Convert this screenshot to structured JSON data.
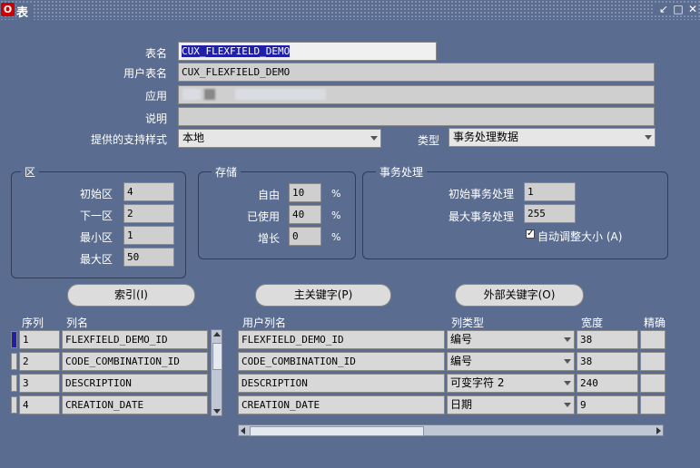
{
  "window": {
    "title": "表",
    "logo": "O"
  },
  "form": {
    "table_name_label": "表名",
    "table_name_value": "CUX_FLEXFIELD_DEMO",
    "user_table_name_label": "用户表名",
    "user_table_name_value": "CUX_FLEXFIELD_DEMO",
    "application_label": "应用",
    "description_label": "说明",
    "support_style_label": "提供的支持样式",
    "support_style_value": "本地",
    "type_label": "类型",
    "type_value": "事务处理数据"
  },
  "extent_group": {
    "title": "区",
    "initial_label": "初始区",
    "initial_value": "4",
    "next_label": "下一区",
    "next_value": "2",
    "min_label": "最小区",
    "min_value": "1",
    "max_label": "最大区",
    "max_value": "50"
  },
  "storage_group": {
    "title": "存储",
    "free_label": "自由",
    "free_value": "10",
    "used_label": "已使用",
    "used_value": "40",
    "growth_label": "增长",
    "growth_value": "0",
    "pct": "%"
  },
  "transaction_group": {
    "title": "事务处理",
    "initial_label": "初始事务处理",
    "initial_value": "1",
    "max_label": "最大事务处理",
    "max_value": "255",
    "autosize_label": "自动调整大小 (A)",
    "autosize_checked": true
  },
  "buttons": {
    "index": "索引(I)",
    "primary_key": "主关键字(P)",
    "foreign_key": "外部关键字(O)"
  },
  "columns_table": {
    "headers": {
      "seq": "序列",
      "col_name": "列名",
      "user_col_name": "用户列名",
      "col_type": "列类型",
      "width": "宽度",
      "precision": "精确"
    },
    "rows": [
      {
        "seq": "1",
        "name": "FLEXFIELD_DEMO_ID",
        "user_name": "FLEXFIELD_DEMO_ID",
        "type": "编号",
        "width": "38"
      },
      {
        "seq": "2",
        "name": "CODE_COMBINATION_ID",
        "user_name": "CODE_COMBINATION_ID",
        "type": "编号",
        "width": "38"
      },
      {
        "seq": "3",
        "name": "DESCRIPTION",
        "user_name": "DESCRIPTION",
        "type": "可变字符 2",
        "width": "240"
      },
      {
        "seq": "4",
        "name": "CREATION_DATE",
        "user_name": "CREATION_DATE",
        "type": "日期",
        "width": "9"
      }
    ]
  }
}
